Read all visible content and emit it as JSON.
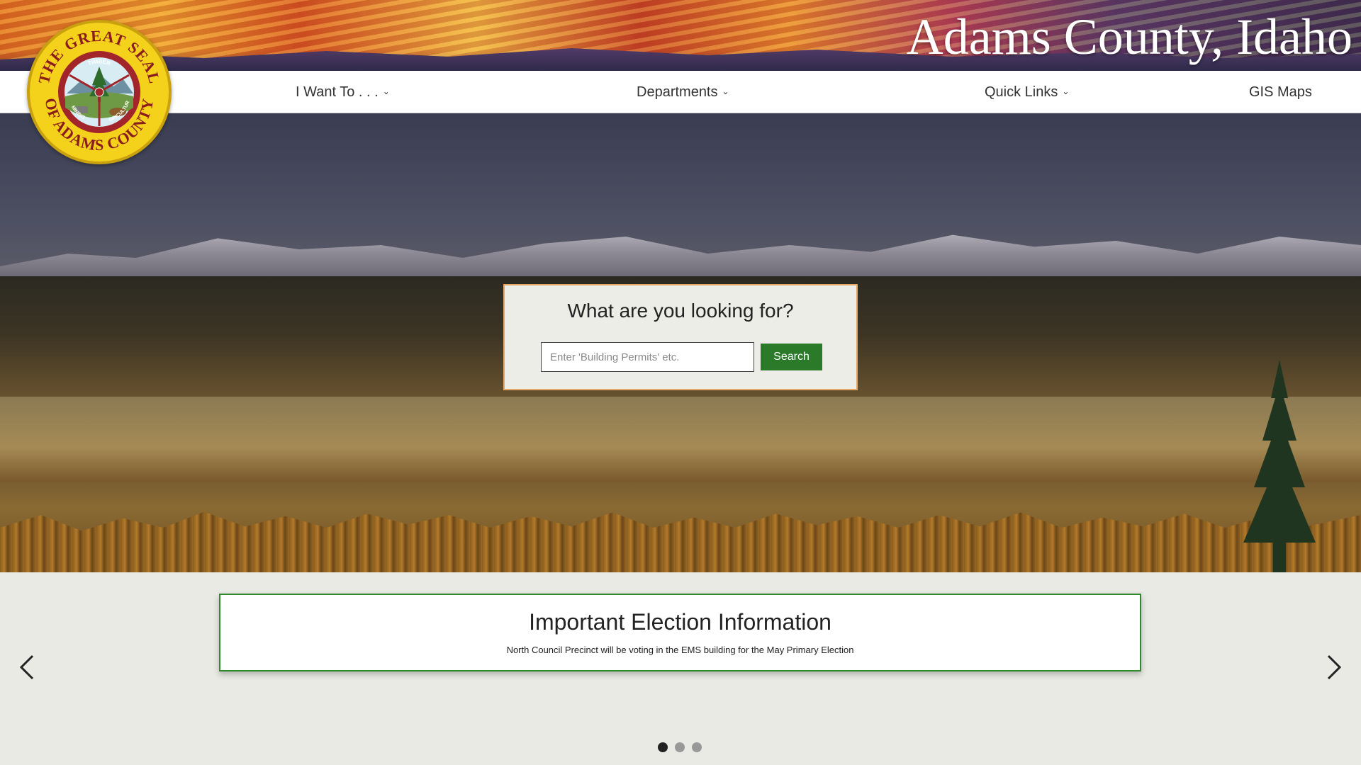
{
  "header": {
    "site_title": "Adams County, Idaho",
    "seal_text": {
      "outer_top": "THE GREAT SEAL",
      "outer_bottom": "OF ADAMS COUNTY",
      "inner_top": "TIMBER",
      "inner_left": "MINING",
      "inner_right": "AGRICULTURE"
    }
  },
  "nav": {
    "items": [
      {
        "label": "I Want To . . .",
        "has_dropdown": true
      },
      {
        "label": "Departments",
        "has_dropdown": true
      },
      {
        "label": "Quick Links",
        "has_dropdown": true
      },
      {
        "label": "GIS Maps",
        "has_dropdown": false
      }
    ]
  },
  "search": {
    "heading": "What are you looking for?",
    "placeholder": "Enter 'Building Permits' etc.",
    "button_label": "Search"
  },
  "announcement": {
    "title": "Important Election Information",
    "body": "North Council Precinct will be voting in the EMS building for the May Primary Election"
  },
  "carousel": {
    "slide_count": 3,
    "active_index": 0
  },
  "colors": {
    "accent_green": "#2a7a2a",
    "search_border": "#e3a768",
    "seal_gold": "#f4d21c",
    "seal_red": "#a2252b"
  }
}
